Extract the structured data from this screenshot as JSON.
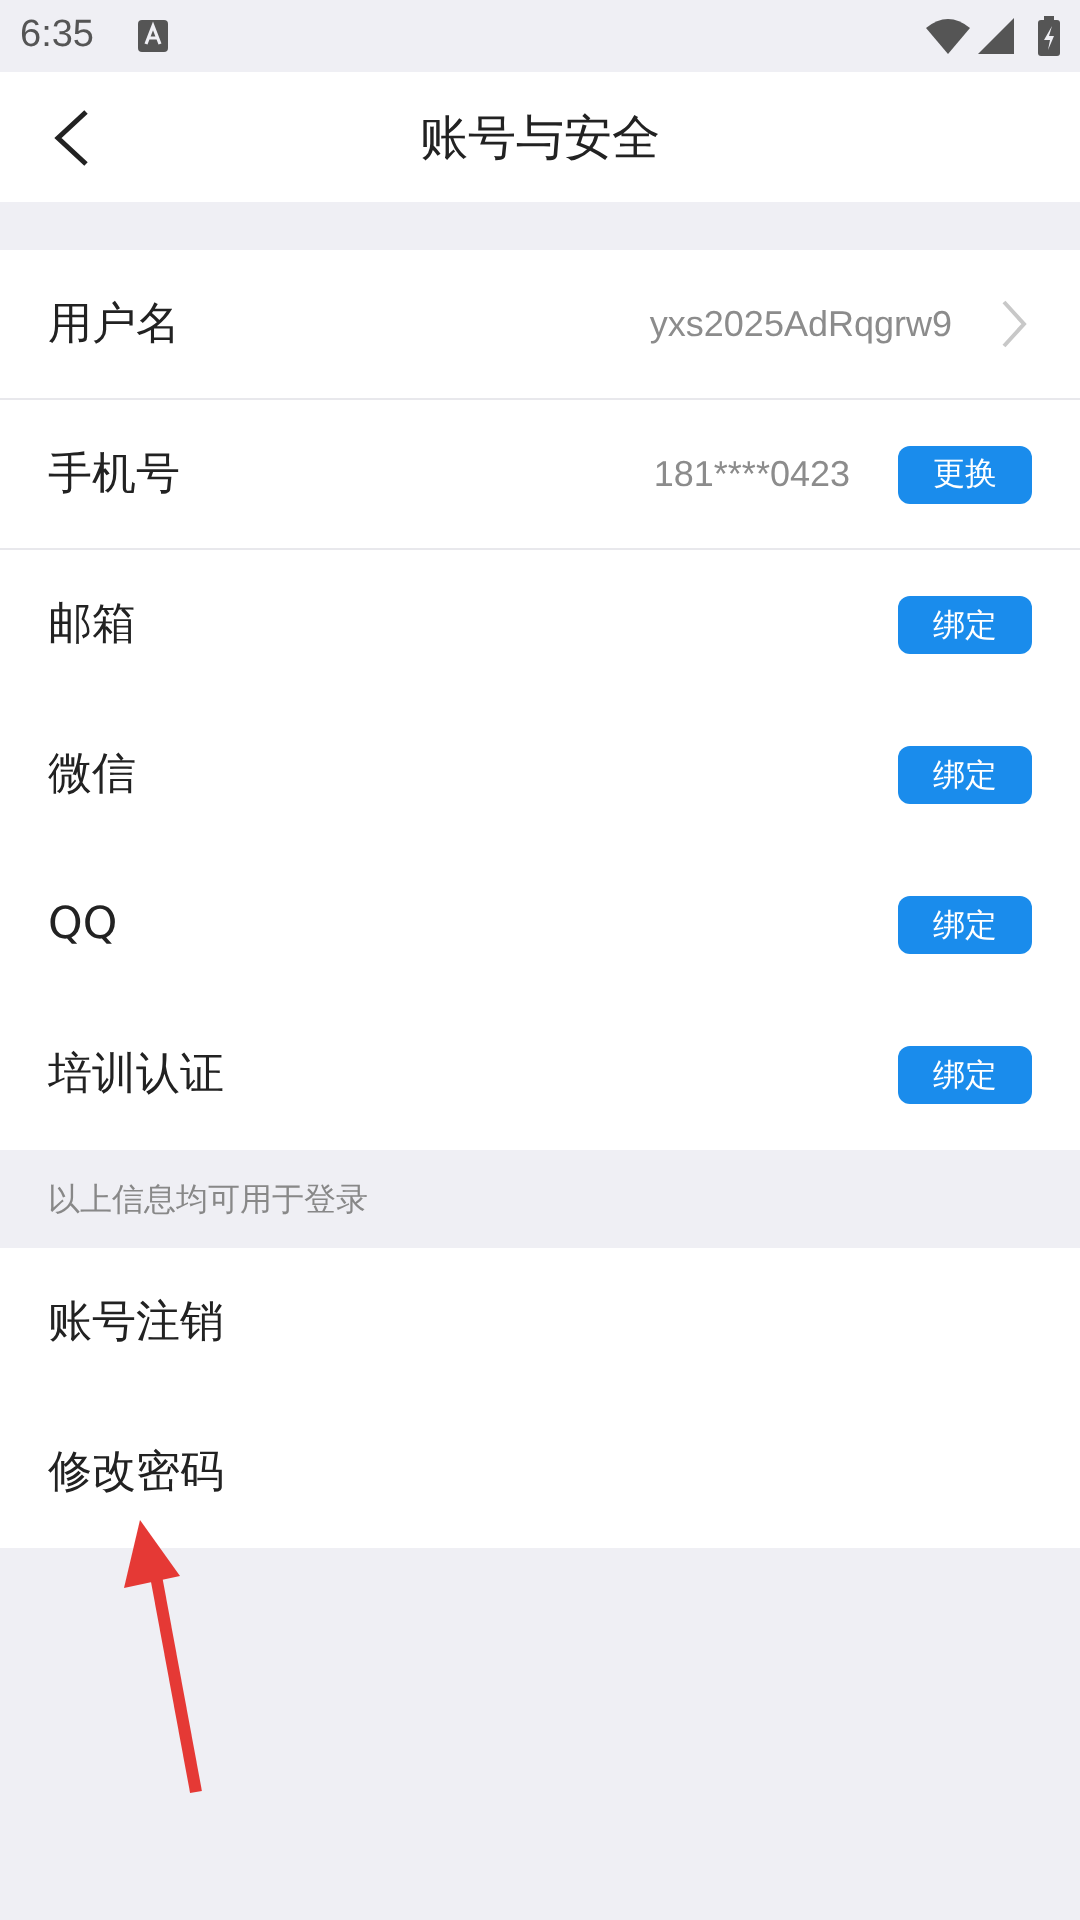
{
  "status_bar": {
    "time": "6:35"
  },
  "header": {
    "title": "账号与安全"
  },
  "account_rows": [
    {
      "kind": "chevron",
      "label": "用户名",
      "value": "yxs2025AdRqgrw9",
      "divider": true
    },
    {
      "kind": "button",
      "label": "手机号",
      "value": "181****0423",
      "button": "更换",
      "divider": true
    },
    {
      "kind": "button",
      "label": "邮箱",
      "button": "绑定",
      "divider": false
    },
    {
      "kind": "button",
      "label": "微信",
      "button": "绑定",
      "divider": false
    },
    {
      "kind": "button",
      "label": "QQ",
      "button": "绑定",
      "divider": false
    },
    {
      "kind": "button",
      "label": "培训认证",
      "button": "绑定",
      "divider": false
    }
  ],
  "note": "以上信息均可用于登录",
  "action_rows": [
    {
      "label": "账号注销"
    },
    {
      "label": "修改密码"
    }
  ]
}
